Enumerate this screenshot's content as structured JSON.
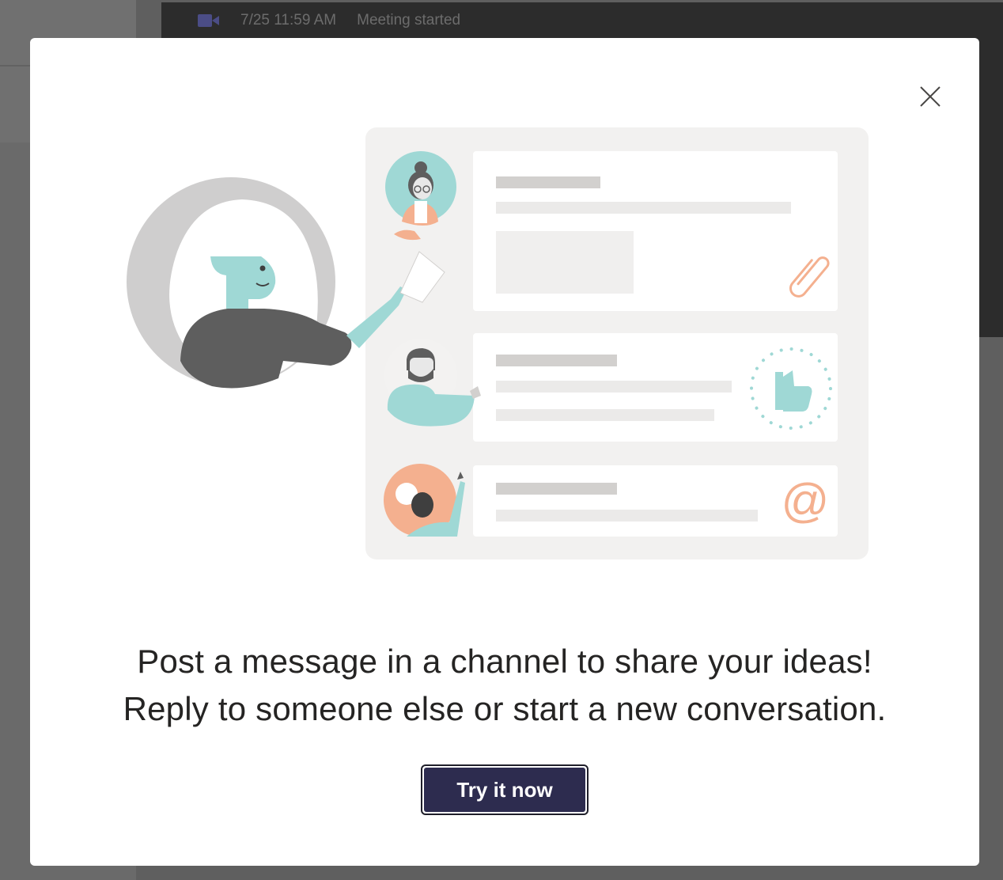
{
  "background": {
    "meeting": {
      "timestamp": "7/25 11:59 AM",
      "status": "Meeting started",
      "icon": "video-camera-icon"
    }
  },
  "dialog": {
    "close_icon": "close-icon",
    "headline_line1": "Post a message in a channel to share your ideas!",
    "headline_line2": "Reply to someone else or start a new conversation.",
    "cta_label": "Try it now",
    "colors": {
      "teal": "#9fd8d5",
      "coral": "#f4b08f",
      "panel": "#f2f1f0",
      "button": "#2d2c4f"
    }
  }
}
